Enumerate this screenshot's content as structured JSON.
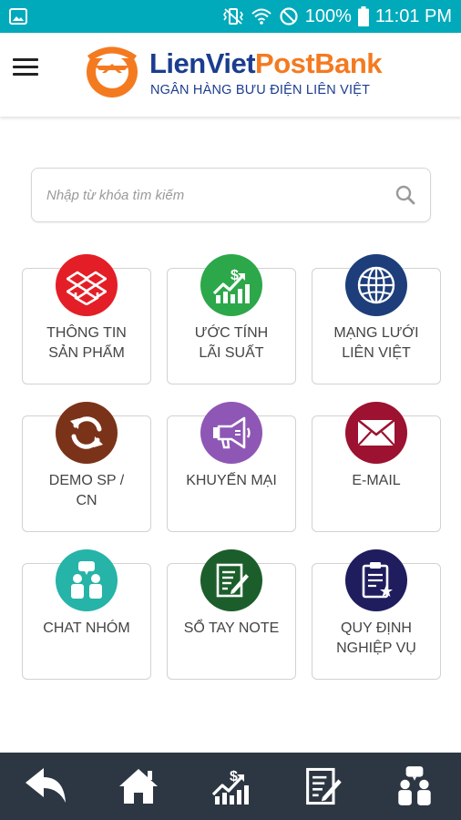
{
  "status_bar": {
    "battery": "100%",
    "time": "11:01 PM"
  },
  "header": {
    "brand_part1": "LienViet",
    "brand_part2": "PostBank",
    "subtitle": "NGÂN HÀNG BƯU ĐIỆN LIÊN VIỆT"
  },
  "search": {
    "placeholder": "Nhập từ khóa tìm kiếm",
    "value": ""
  },
  "tiles": [
    {
      "line1": "THÔNG TIN",
      "line2": "SẢN PHẨM",
      "icon": "dropbox-icon",
      "color": "#e41e26"
    },
    {
      "line1": "ƯỚC TÍNH",
      "line2": "LÃI SUẤT",
      "icon": "money-growth-icon",
      "color": "#2ca84a"
    },
    {
      "line1": "MẠNG LƯỚI",
      "line2": "LIÊN VIỆT",
      "icon": "globe-icon",
      "color": "#1d3e7a"
    },
    {
      "line1": "DEMO SP /",
      "line2": "CN",
      "icon": "refresh-icon",
      "color": "#7a3319"
    },
    {
      "line1": "KHUYẾN MẠI",
      "line2": "",
      "icon": "megaphone-icon",
      "color": "#8e57b5"
    },
    {
      "line1": "E-MAIL",
      "line2": "",
      "icon": "envelope-icon",
      "color": "#9c1230"
    },
    {
      "line1": "CHAT NHÓM",
      "line2": "",
      "icon": "group-chat-icon",
      "color": "#26b3a8"
    },
    {
      "line1": "SỔ TAY NOTE",
      "line2": "",
      "icon": "notepad-icon",
      "color": "#1c5e2b"
    },
    {
      "line1": "QUY ĐỊNH",
      "line2": "NGHIỆP VỤ",
      "icon": "clipboard-star-icon",
      "color": "#1f1d5e"
    }
  ],
  "bottom_nav": [
    "back-arrow-icon",
    "home-icon",
    "money-growth-icon",
    "notepad-icon",
    "group-chat-icon"
  ],
  "colors": {
    "status_bar": "#00aabb",
    "brand_blue": "#1b3d8f",
    "brand_orange": "#f47a20",
    "bottom_bar": "#2d3743"
  }
}
